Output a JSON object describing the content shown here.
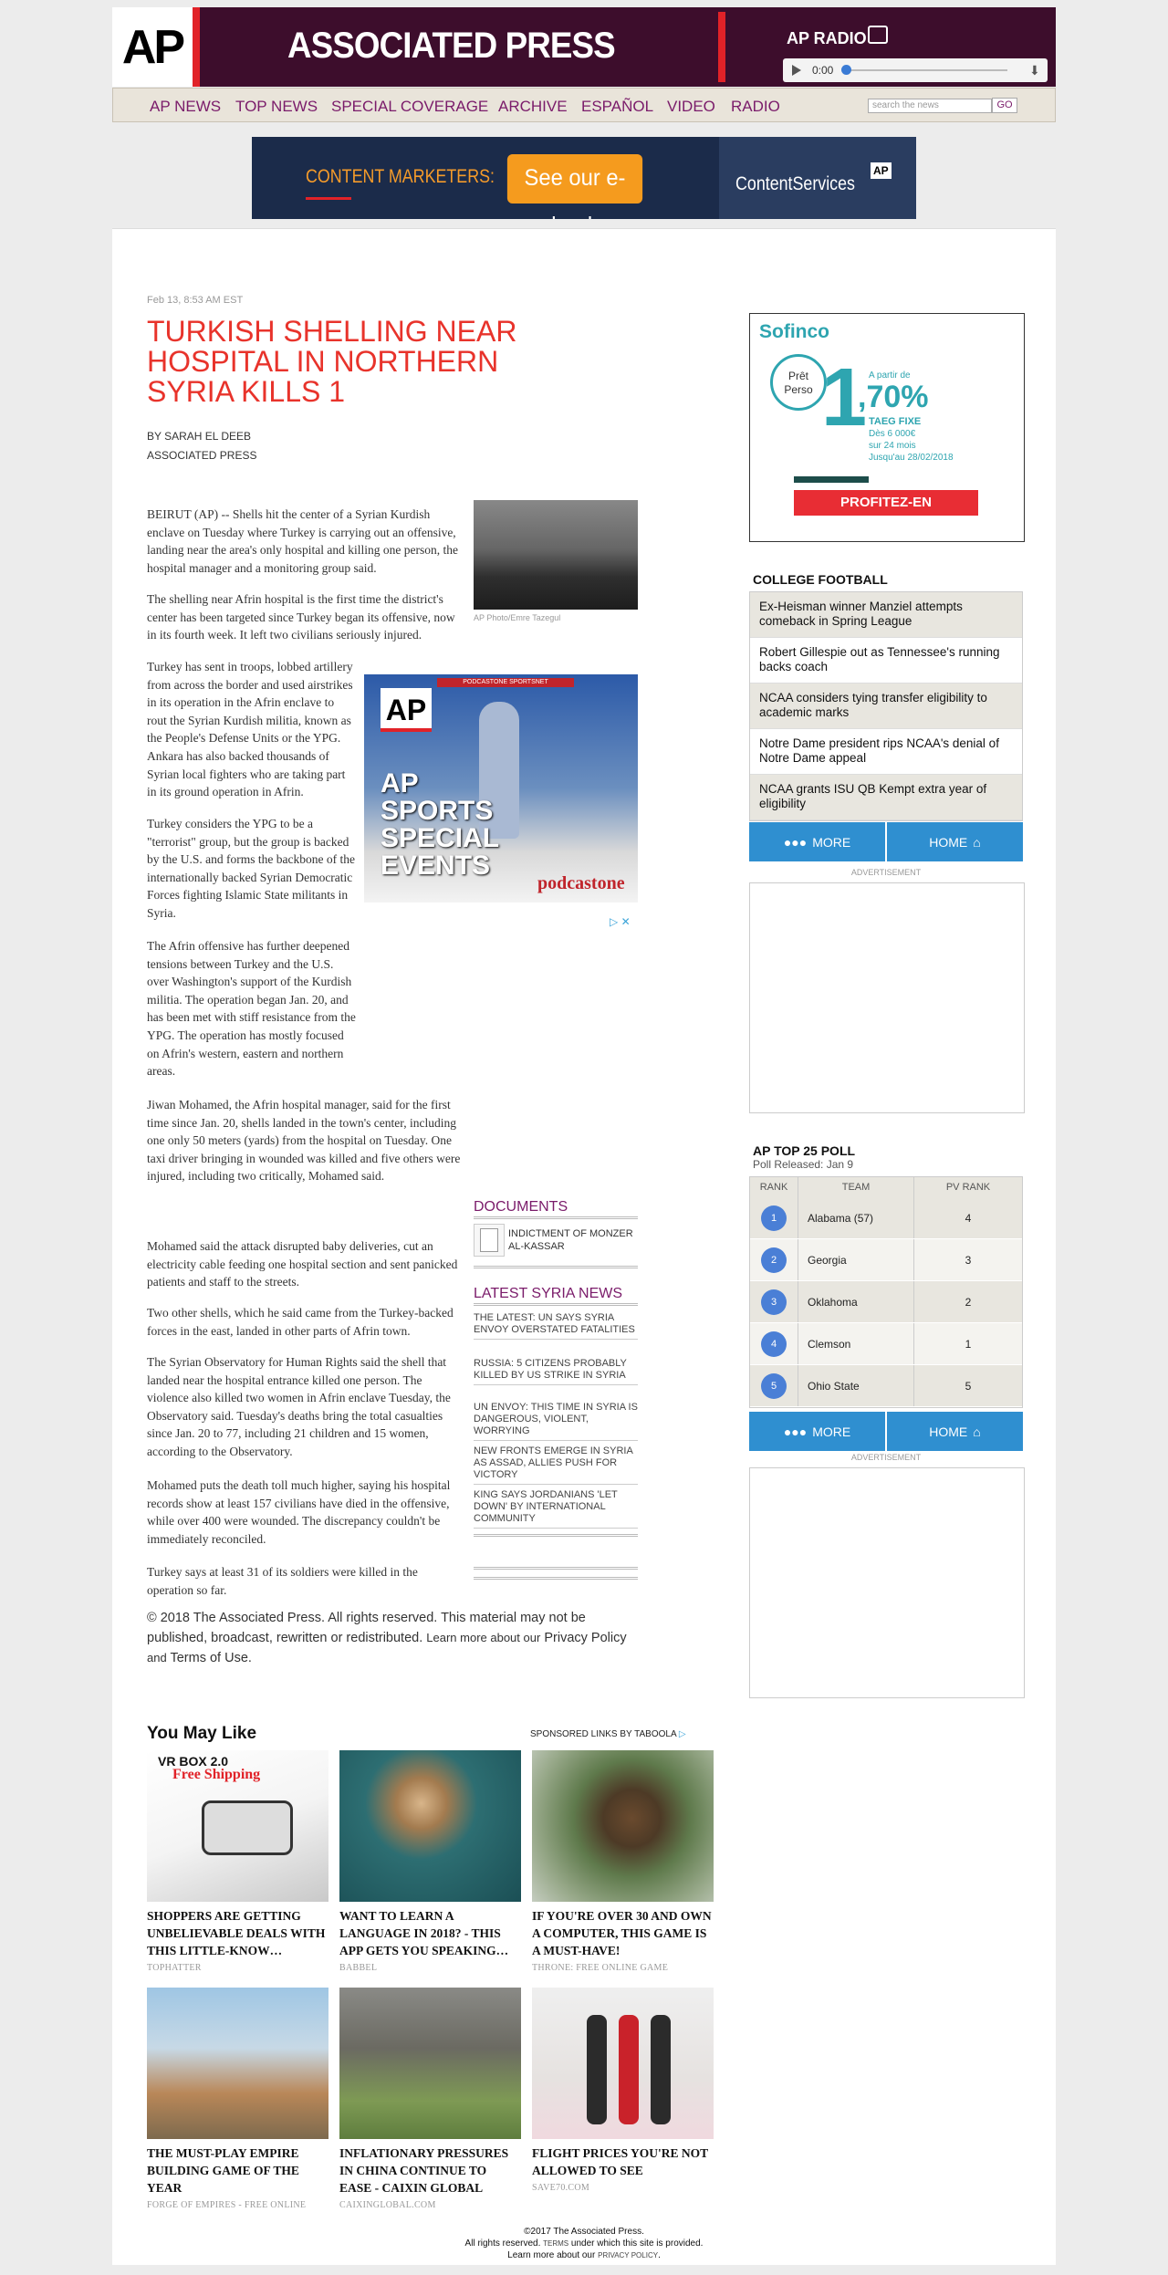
{
  "header": {
    "logo": "AP",
    "brand": "ASSOCIATED PRESS",
    "radio_title": "AP RADIO",
    "player_time": "0:00",
    "progress": 0
  },
  "nav": {
    "items": [
      "AP NEWS",
      "TOP NEWS",
      "SPECIAL COVERAGE",
      "ARCHIVE",
      "ESPAÑOL",
      "VIDEO",
      "RADIO"
    ],
    "search_placeholder": "search the news",
    "go_label": "GO"
  },
  "banner": {
    "text": "CONTENT MARKETERS:",
    "button": "See our e-book",
    "brand": "ContentServices",
    "brand_mark": "AP"
  },
  "article": {
    "date": "Feb 13, 8:53 AM EST",
    "headline": "TURKISH SHELLING NEAR HOSPITAL IN NORTHERN SYRIA KILLS 1",
    "byline": "BY SARAH EL DEEB",
    "byline_org": "ASSOCIATED PRESS",
    "photo_caption": "AP Photo/Emre Tazegul",
    "paragraphs": [
      "BEIRUT (AP) -- Shells hit the center of a Syrian Kurdish enclave on Tuesday where Turkey is carrying out an offensive, landing near the area's only hospital and killing one person, the hospital manager and a monitoring group said.",
      "The shelling near Afrin hospital is the first time the district's center has been targeted since Turkey began its offensive, now in its fourth week. It left two civilians seriously injured.",
      "Turkey has sent in troops, lobbed artillery from across the border and used airstrikes in its operation in the Afrin enclave to rout the Syrian Kurdish militia, known as the People's Defense Units or the YPG. Ankara has also backed thousands of Syrian local fighters who are taking part in its ground operation in Afrin.",
      "Turkey considers the YPG to be a \"terrorist\" group, but the group is backed by the U.S. and forms the backbone of the internationally backed Syrian Democratic Forces fighting Islamic State militants in Syria.",
      "The Afrin offensive has further deepened tensions between Turkey and the U.S. over Washington's support of the Kurdish militia. The operation began Jan. 20, and has been met with stiff resistance from the YPG. The operation has mostly focused on Afrin's western, eastern and northern areas.",
      "Jiwan Mohamed, the Afrin hospital manager, said for the first time since Jan. 20, shells landed in the town's center, including one only 50 meters (yards) from the hospital on Tuesday. One taxi driver bringing in wounded was killed and five others were injured, including two critically, Mohamed said.",
      "Mohamed said the attack disrupted baby deliveries, cut an electricity cable feeding one hospital section and sent panicked patients and staff to the streets.",
      "Two other shells, which he said came from the Turkey-backed forces in the east, landed in other parts of Afrin town.",
      "The Syrian Observatory for Human Rights said the shell that landed near the hospital entrance killed one person. The violence also killed two women in Afrin enclave Tuesday, the Observatory said. Tuesday's deaths bring the total casualties since Jan. 20 to 77, including 21 children and 15 women, according to the Observatory.",
      "Mohamed puts the death toll much higher, saying his hospital records show at least 157 civilians have died in the offensive, while over 400 were wounded. The discrepancy couldn't be immediately reconciled.",
      "Turkey says at least 31 of its soldiers were killed in the operation so far."
    ],
    "copyright": "© 2018 The Associated Press. All rights reserved. This material may not be published, broadcast, rewritten or redistributed.",
    "learn_more": "Learn more about our",
    "privacy": "Privacy Policy",
    "and_terms": "and",
    "terms": "Terms of Use."
  },
  "sports_ad": {
    "bar": "PODCASTONE SPORTSNET",
    "logo": "AP",
    "text_lines": [
      "AP",
      "SPORTS",
      "SPECIAL",
      "EVENTS"
    ],
    "brand": "podcastone",
    "adchoices": "▷ ✕"
  },
  "documents": {
    "title": "DOCUMENTS",
    "item": "INDICTMENT OF MONZER AL-KASSAR"
  },
  "latest_syria": {
    "title": "LATEST SYRIA NEWS",
    "items": [
      "THE LATEST: UN SAYS SYRIA ENVOY OVERSTATED FATALITIES",
      "RUSSIA: 5 CITIZENS PROBABLY KILLED BY US STRIKE IN SYRIA",
      "UN ENVOY: THIS TIME IN SYRIA IS DANGEROUS, VIOLENT, WORRYING",
      "NEW FRONTS EMERGE IN SYRIA AS ASSAD, ALLIES PUSH FOR VICTORY",
      "KING SAYS JORDANIANS 'LET DOWN' BY INTERNATIONAL COMMUNITY"
    ]
  },
  "sofinco_ad": {
    "logo": "Sofinco",
    "pret": "Prêt Perso",
    "a_partir": "A partir de",
    "rate_big": "1",
    "rate_rest": ",70%",
    "taeg": "TAEG FIXE",
    "cond1": "Dès 6 000€",
    "cond2": "sur 24 mois",
    "cond3": "Jusqu'au 28/02/2018",
    "button": "PROFITEZ-EN"
  },
  "college_football": {
    "title": "COLLEGE FOOTBALL",
    "items": [
      "Ex-Heisman winner Manziel attempts comeback in Spring League",
      "Robert Gillespie out as Tennessee's running backs coach",
      "NCAA considers tying transfer eligibility to academic marks",
      "Notre Dame president rips NCAA's denial of Notre Dame appeal",
      "NCAA grants ISU QB Kempt extra year of eligibility"
    ],
    "more": "MORE",
    "home": "HOME"
  },
  "advertisement_label": "ADVERTISEMENT",
  "poll": {
    "title": "AP TOP 25 POLL",
    "released": "Poll Released: Jan 9",
    "headers": [
      "RANK",
      "TEAM",
      "PV RANK"
    ],
    "rows": [
      {
        "rank": "1",
        "team": "Alabama (57)",
        "pv": "4"
      },
      {
        "rank": "2",
        "team": "Georgia",
        "pv": "3"
      },
      {
        "rank": "3",
        "team": "Oklahoma",
        "pv": "2"
      },
      {
        "rank": "4",
        "team": "Clemson",
        "pv": "1"
      },
      {
        "rank": "5",
        "team": "Ohio State",
        "pv": "5"
      }
    ],
    "more": "MORE",
    "home": "HOME"
  },
  "you_may_like": {
    "title": "You May Like",
    "sponsored": "SPONSORED LINKS BY TABOOLA",
    "cards": [
      {
        "caption": "SHOPPERS ARE GETTING UNBELIEVABLE DEALS WITH THIS LITTLE-KNOW…",
        "source": "TOPHATTER",
        "img_text": "VR BOX 2.0",
        "img_sub": "Free Shipping"
      },
      {
        "caption": "WANT TO LEARN A LANGUAGE IN 2018? - THIS APP GETS YOU SPEAKING…",
        "source": "BABBEL"
      },
      {
        "caption": "IF YOU'RE OVER 30 AND OWN A COMPUTER, THIS GAME IS A MUST-HAVE!",
        "source": "THRONE: FREE ONLINE GAME"
      },
      {
        "caption": "THE MUST-PLAY EMPIRE BUILDING GAME OF THE YEAR",
        "source": "FORGE OF EMPIRES - FREE ONLINE"
      },
      {
        "caption": "INFLATIONARY PRESSURES IN CHINA CONTINUE TO EASE - CAIXIN GLOBAL",
        "source": "CAIXINGLOBAL.COM"
      },
      {
        "caption": "FLIGHT PRICES YOU'RE NOT ALLOWED TO SEE",
        "source": "SAVE70.COM"
      }
    ]
  },
  "footer": {
    "line1": "©2017 The Associated Press.",
    "line2a": "All rights reserved.",
    "terms": "TERMS",
    "line2b": "under which this site is provided.",
    "line3a": "Learn more about our",
    "privacy": "PRIVACY POLICY",
    "line3b": "."
  },
  "colors": {
    "header_bg": "#3d0d2c",
    "accent_red": "#e12228",
    "headline": "#e8332b",
    "link_purple": "#7a1b6a",
    "button_blue": "#2f8fd0"
  }
}
